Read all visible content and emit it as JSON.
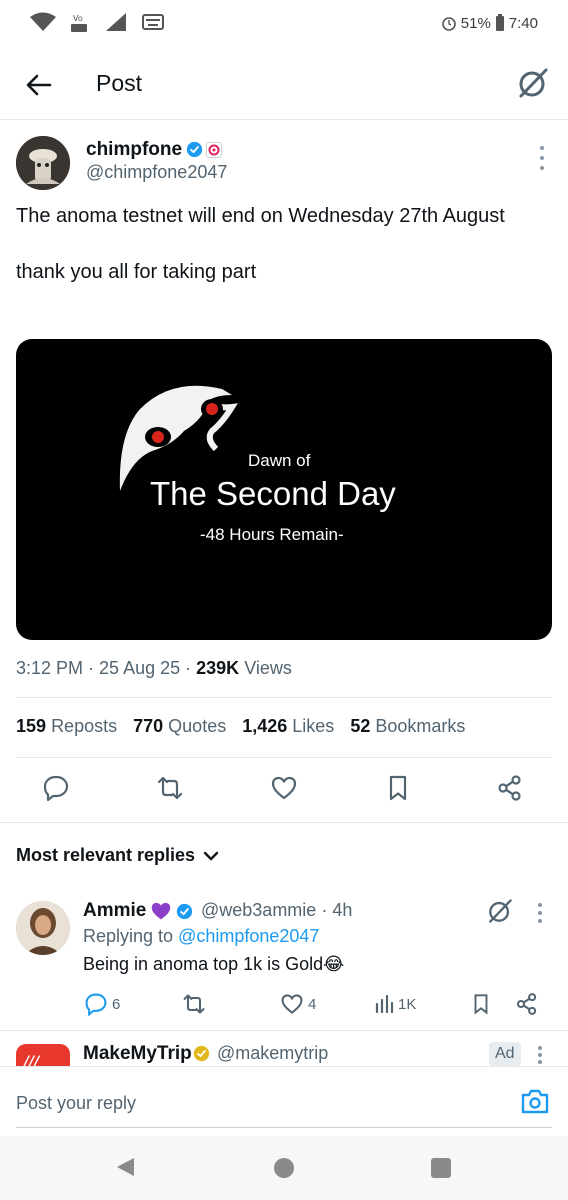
{
  "status_bar": {
    "battery": "51%",
    "time": "7:40"
  },
  "header": {
    "title": "Post"
  },
  "tweet": {
    "author_name": "chimpfone",
    "author_handle": "@chimpfone2047",
    "text_line1": "The anoma testnet will end on Wednesday 27th August",
    "text_line2": "thank you all for taking part",
    "media": {
      "line1": "Dawn of",
      "line2": "The Second Day",
      "line3": "-48 Hours Remain-"
    },
    "time": "3:12 PM",
    "date": "25 Aug 25",
    "views_count": "239K",
    "views_label": "Views",
    "reposts_count": "159",
    "reposts_label": "Reposts",
    "quotes_count": "770",
    "quotes_label": "Quotes",
    "likes_count": "1,426",
    "likes_label": "Likes",
    "bookmarks_count": "52",
    "bookmarks_label": "Bookmarks"
  },
  "replies": {
    "sort_label": "Most relevant replies",
    "items": [
      {
        "name": "Ammie",
        "handle": "@web3ammie",
        "age": "4h",
        "replying_prefix": "Replying to",
        "replying_to": "@chimpfone2047",
        "text": "Being in anoma top 1k is Gold😂",
        "reply_count": "6",
        "like_count": "4",
        "view_count": "1K"
      }
    ]
  },
  "ad": {
    "name": "MakeMyTrip",
    "handle": "@makemytrip",
    "badge": "Ad"
  },
  "composer": {
    "placeholder": "Post your reply"
  },
  "colors": {
    "accent": "#1d9bf0",
    "text": "#0f1419",
    "muted": "#536471",
    "ad_brand": "#e8372c"
  }
}
